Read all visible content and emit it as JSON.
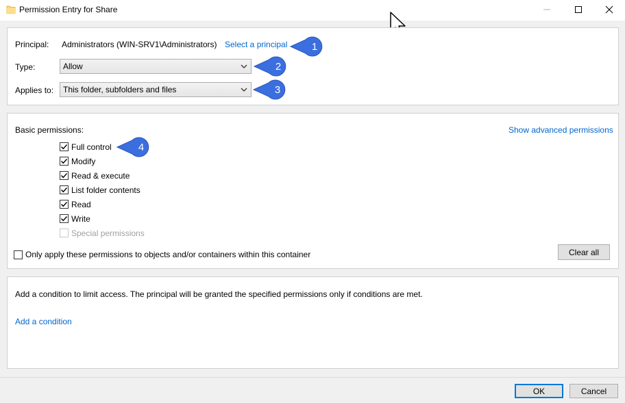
{
  "window": {
    "title": "Permission Entry for Share",
    "icon": "folder-icon"
  },
  "principal": {
    "label": "Principal:",
    "value": "Administrators (WIN-SRV1\\Administrators)",
    "link": "Select a principal"
  },
  "type": {
    "label": "Type:",
    "selected": "Allow"
  },
  "applies_to": {
    "label": "Applies to:",
    "selected": "This folder, subfolders and files"
  },
  "basic_permissions": {
    "label": "Basic permissions:",
    "advanced_link": "Show advanced permissions",
    "items": [
      {
        "label": "Full control",
        "checked": true,
        "enabled": true
      },
      {
        "label": "Modify",
        "checked": true,
        "enabled": true
      },
      {
        "label": "Read & execute",
        "checked": true,
        "enabled": true
      },
      {
        "label": "List folder contents",
        "checked": true,
        "enabled": true
      },
      {
        "label": "Read",
        "checked": true,
        "enabled": true
      },
      {
        "label": "Write",
        "checked": true,
        "enabled": true
      },
      {
        "label": "Special permissions",
        "checked": false,
        "enabled": false
      }
    ],
    "only_apply": {
      "label": "Only apply these permissions to objects and/or containers within this container",
      "checked": false
    },
    "clear_all": "Clear all"
  },
  "condition": {
    "description": "Add a condition to limit access. The principal will be granted the specified permissions only if conditions are met.",
    "link": "Add a condition"
  },
  "footer": {
    "ok": "OK",
    "cancel": "Cancel"
  },
  "callouts": [
    "1",
    "2",
    "3",
    "4"
  ],
  "colors": {
    "link": "#0066cc",
    "callout": "#3b6fe0",
    "default_button_border": "#0078d7"
  }
}
